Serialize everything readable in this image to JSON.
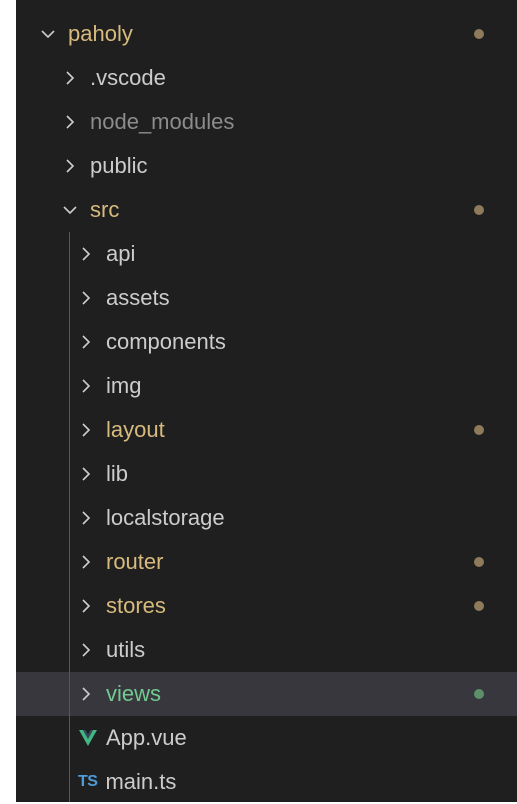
{
  "explorer": {
    "colors": {
      "background": "#1f1f1f",
      "selected_row": "#37373d",
      "text_default": "#cccccc",
      "text_modified": "#d7ba7d",
      "text_ignored": "#8c8c8c",
      "text_untracked": "#73c991",
      "dot_modified": "#8e7b5c",
      "dot_untracked": "#5d8f6b",
      "vue_icon": "#41b883",
      "ts_icon": "#4f9bd9"
    },
    "root": {
      "name": "paholy",
      "icon": "chevron-down-icon"
    },
    "root_children": [
      {
        "name": ".vscode",
        "icon": "chevron-right-icon"
      },
      {
        "name": "node_modules",
        "icon": "chevron-right-icon"
      },
      {
        "name": "public",
        "icon": "chevron-right-icon"
      }
    ],
    "src": {
      "name": "src",
      "icon": "chevron-down-icon"
    },
    "src_children": [
      {
        "name": "api",
        "icon": "chevron-right-icon"
      },
      {
        "name": "assets",
        "icon": "chevron-right-icon"
      },
      {
        "name": "components",
        "icon": "chevron-right-icon"
      },
      {
        "name": "img",
        "icon": "chevron-right-icon"
      },
      {
        "name": "layout",
        "icon": "chevron-right-icon"
      },
      {
        "name": "lib",
        "icon": "chevron-right-icon"
      },
      {
        "name": "localstorage",
        "icon": "chevron-right-icon"
      },
      {
        "name": "router",
        "icon": "chevron-right-icon"
      },
      {
        "name": "stores",
        "icon": "chevron-right-icon"
      },
      {
        "name": "utils",
        "icon": "chevron-right-icon"
      },
      {
        "name": "views",
        "icon": "chevron-right-icon"
      }
    ],
    "files": [
      {
        "name": "App.vue",
        "icon": "vue-file-icon"
      },
      {
        "name": "main.ts",
        "icon": "typescript-file-icon",
        "icon_text": "TS"
      }
    ]
  }
}
